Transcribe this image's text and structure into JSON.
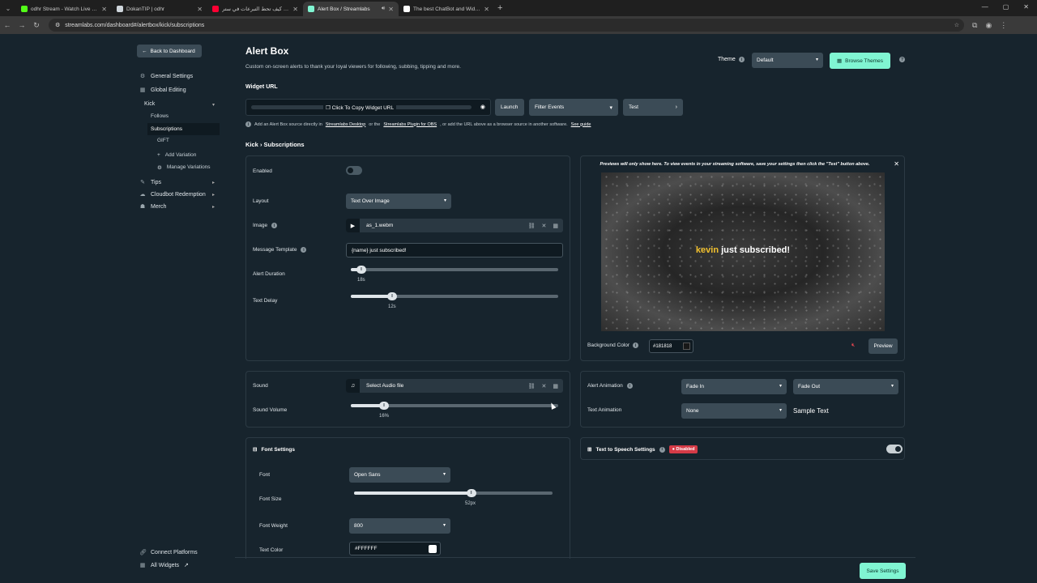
{
  "browser": {
    "tabs": [
      {
        "label": "odhr Stream - Watch Live on Ki",
        "color": "#53fc18",
        "active": false
      },
      {
        "label": "DokanTIP | odhr",
        "color": "#cfd6dc",
        "active": false
      },
      {
        "label": "شرح كيف تحط التبرعات في ستر...",
        "color": "#ff0033",
        "active": false
      },
      {
        "label": "Alert Box / Streamlabs",
        "color": "#80f5d2",
        "active": true
      },
      {
        "label": "The best ChatBot and Widgets",
        "color": "#ffffff",
        "active": false
      }
    ],
    "url": "streamlabs.com/dashboard#/alertbox/kick/subscriptions"
  },
  "sidebar": {
    "back_label": "Back to Dashboard",
    "general_settings": "General Settings",
    "global_editing": "Global Editing",
    "kick": "Kick",
    "follows": "Follows",
    "subscriptions": "Subscriptions",
    "gift": "GIFT",
    "add_variation": "Add Variation",
    "manage_variations": "Manage Variations",
    "tips": "Tips",
    "cloudbot": "Cloudbot Redemption",
    "merch": "Merch",
    "connect_platforms": "Connect Platforms",
    "all_widgets": "All Widgets"
  },
  "header": {
    "title": "Alert Box",
    "description": "Custom on-screen alerts to thank your loyal viewers for following, subbing, tipping and more.",
    "theme_label": "Theme",
    "theme_value": "Default",
    "browse_themes": "Browse Themes"
  },
  "widget_url": {
    "label": "Widget URL",
    "copy_label": "Click To Copy Widget URL",
    "launch": "Launch",
    "filter_events": "Filter Events",
    "test": "Test",
    "note_pre": "Add an Alert Box source directly in",
    "note_link1": "Streamlabs Desktop",
    "note_mid": "or the",
    "note_link2": "Streamlabs Plugin for OBS",
    "note_post": ", or add the URL above as a browser source in another software.",
    "note_link3": "See guide"
  },
  "breadcrumb": {
    "parent": "Kick",
    "sep": "›",
    "current": "Subscriptions"
  },
  "settings": {
    "enabled": "Enabled",
    "layout_label": "Layout",
    "layout_value": "Text Over Image",
    "image_label": "Image",
    "image_file": "as_1.webm",
    "message_label": "Message Template",
    "message_value": "{name} just subscribed!",
    "duration_label": "Alert Duration",
    "duration_value": "18s",
    "duration_fraction": 0.05,
    "delay_label": "Text Delay",
    "delay_value": "12s",
    "delay_fraction": 0.2
  },
  "preview": {
    "note": "Previews will only show here. To view events in your streaming software, save your settings then click the \"Test\" button above.",
    "name": "kevin",
    "message": " just subscribed!",
    "bg_label": "Background Color",
    "bg_value": "#181818",
    "preview_btn": "Preview"
  },
  "sound": {
    "label": "Sound",
    "file": "Select Audio file",
    "volume_label": "Sound Volume",
    "volume_value": "16%",
    "volume_fraction": 0.16
  },
  "animation": {
    "alert_label": "Alert Animation",
    "in_value": "Fade In",
    "out_value": "Fade Out",
    "text_label": "Text Animation",
    "text_value": "None",
    "sample": "Sample Text"
  },
  "font": {
    "section": "Font Settings",
    "font_label": "Font",
    "font_value": "Open Sans",
    "size_label": "Font Size",
    "size_value": "52px",
    "size_fraction": 0.59,
    "weight_label": "Font Weight",
    "weight_value": "800",
    "color_label": "Text Color",
    "color_value": "#FFFFFF"
  },
  "tts": {
    "label": "Text to Speech Settings",
    "badge": "Disabled"
  },
  "save": "Save Settings"
}
